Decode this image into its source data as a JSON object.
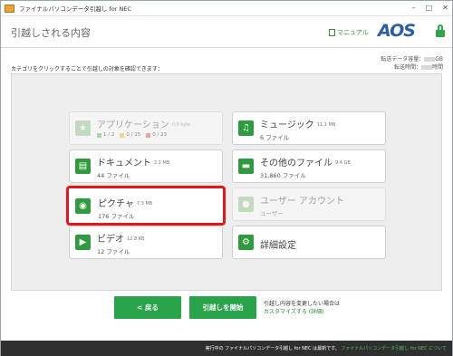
{
  "window": {
    "title": "ファイナルパソコンデータ引越し for NEC"
  },
  "header": {
    "page_title": "引越しされる内容",
    "manual_label": "マニュアル",
    "logo": "AOS"
  },
  "instruction": "カテゴリをクリックすることで引越しの対象を確認できます：",
  "stats": {
    "capacity_label": "転送データ容量：",
    "capacity_unit": "GB",
    "time_label": "転送時間：",
    "time_unit": "時間"
  },
  "tiles": {
    "applications": {
      "title": "アプリケーション",
      "size": "0.0 kyte",
      "chip1": "1 / 2",
      "chip2": "0 / 15",
      "chip3": "0 / 23",
      "icon": "star-icon",
      "state": "disabled"
    },
    "music": {
      "title": "ミュージック",
      "size": "11.1 MB",
      "subtitle": "6 ファイル",
      "icon": "music-note-icon"
    },
    "documents": {
      "title": "ドキュメント",
      "size": "2.1 MB",
      "subtitle": "44 ファイル",
      "icon": "document-icon"
    },
    "other_files": {
      "title": "その他のファイル",
      "size": "9.4 GB",
      "subtitle": "31,860 ファイル",
      "icon": "folder-icon"
    },
    "pictures": {
      "title": "ピクチャ",
      "size": "7.3 MB",
      "subtitle": "176 ファイル",
      "icon": "camera-icon",
      "state": "selected"
    },
    "user_accounts": {
      "title": "ユーザー アカウント",
      "subtitle": "ユーザー",
      "icon": "user-icon",
      "state": "disabled"
    },
    "videos": {
      "title": "ビデオ",
      "size": "12.8 KB",
      "subtitle": "12 ファイル",
      "icon": "play-icon"
    },
    "advanced": {
      "title": "詳細設定",
      "icon": "gear-icon"
    }
  },
  "buttons": {
    "back": "< 戻る",
    "start": "引越しを開始"
  },
  "customize": {
    "note": "引越し内容を変更したい場合は",
    "link": "カスタマイズする (詳細)"
  },
  "footer": {
    "text": "実行中の ファイナルパソコンデータ引越し for NEC は最新です。",
    "link": "ファイナルパソコンデータ引越し for NEC について"
  },
  "colors": {
    "accent_green": "#2aa44a",
    "selection_red": "#e8141c",
    "logo_blue": "#2a5da8"
  }
}
